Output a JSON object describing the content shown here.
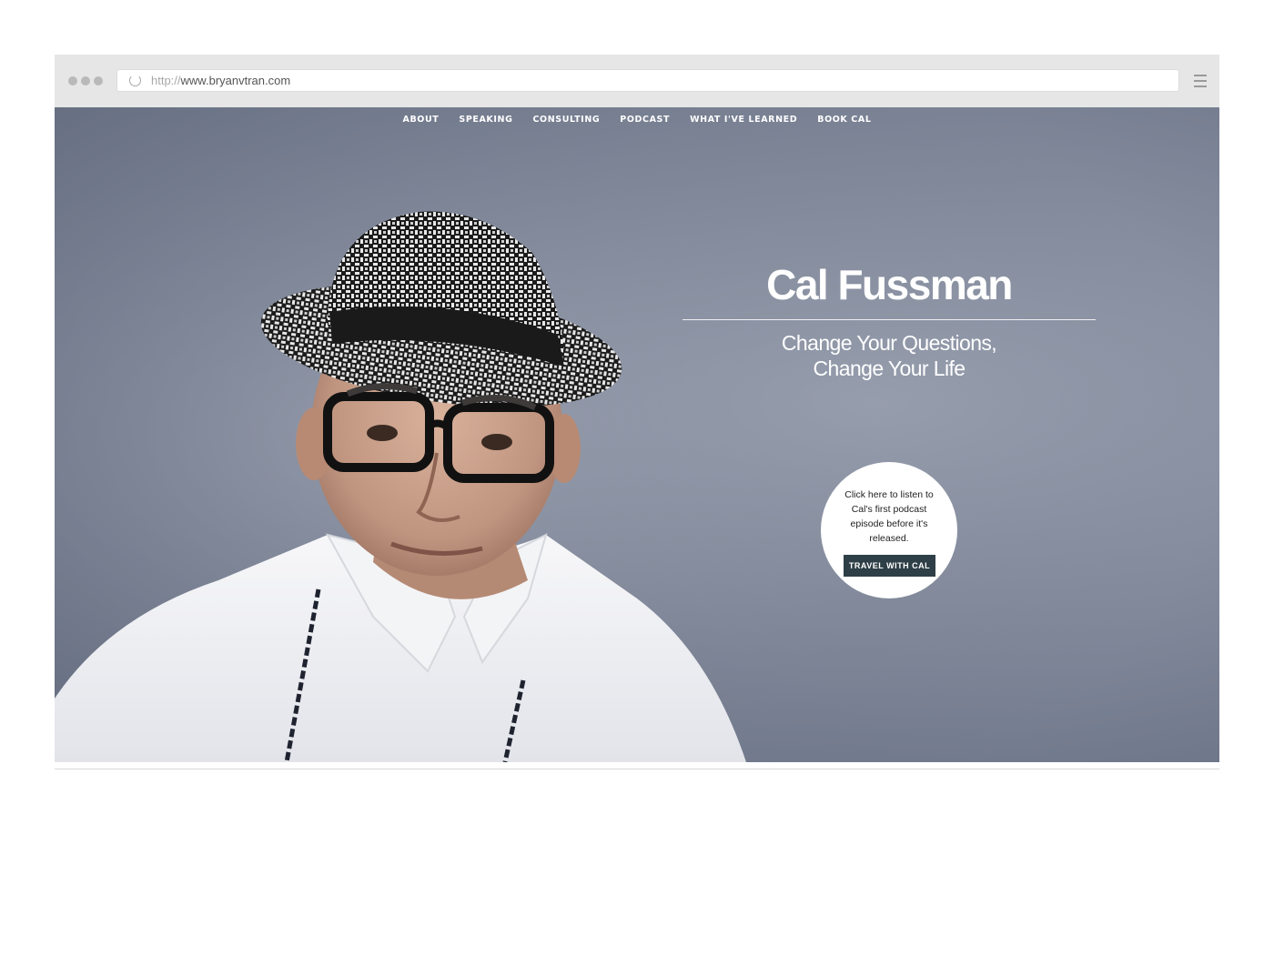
{
  "browser": {
    "url_protocol": "http://",
    "url_host": "www.bryanvtran.com"
  },
  "nav": {
    "items": [
      "ABOUT",
      "SPEAKING",
      "CONSULTING",
      "PODCAST",
      "WHAT I'VE LEARNED",
      "BOOK CAL"
    ]
  },
  "hero": {
    "title": "Cal Fussman",
    "subtitle_line1": "Change Your Questions,",
    "subtitle_line2": "Change Your Life",
    "cta_text": "Click here to listen to Cal's first podcast episode before it's released.",
    "cta_button": "TRAVEL WITH CAL"
  },
  "colors": {
    "hero_background": "#8b93a4",
    "cta_button_bg": "#2f3f47",
    "chrome_bg": "#e6e6e6"
  }
}
